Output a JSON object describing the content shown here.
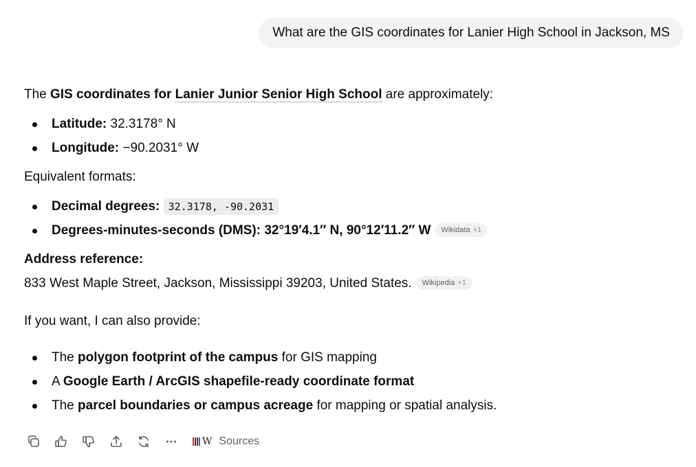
{
  "user_message": "What are the GIS coordinates for Lanier High School in Jackson, MS",
  "answer": {
    "intro": {
      "prefix": "The ",
      "bold": "GIS coordinates for ",
      "link": "Lanier Junior Senior High School",
      "suffix": " are approximately:"
    },
    "coords": [
      {
        "label": "Latitude:",
        "value": " 32.3178° N"
      },
      {
        "label": "Longitude:",
        "value": " −90.2031° W"
      }
    ],
    "equivalent_heading": "Equivalent formats:",
    "decimal": {
      "label": "Decimal degrees:",
      "code": "32.3178, -90.2031"
    },
    "dms": {
      "label": "Degrees-minutes-seconds (DMS): 32°19′4.1″ N, 90°12′11.2″ W",
      "chip": "Wikidata",
      "chip_plus": "+1"
    },
    "address_heading": "Address reference:",
    "address": {
      "text": "833 West Maple Street, Jackson, Mississippi 39203, United States.",
      "chip": "Wikipedia",
      "chip_plus": "+1"
    },
    "offer_intro": "If you want, I can also provide:",
    "offers": [
      {
        "pre": "The ",
        "bold": "polygon footprint of the campus",
        "post": " for GIS mapping"
      },
      {
        "pre": "A ",
        "bold": "Google Earth / ArcGIS shapefile-ready coordinate format",
        "post": ""
      },
      {
        "pre": "The ",
        "bold": "parcel boundaries or campus acreage",
        "post": " for mapping or spatial analysis."
      }
    ]
  },
  "toolbar": {
    "icons": [
      "copy-icon",
      "thumbs-up-icon",
      "thumbs-down-icon",
      "share-icon",
      "regenerate-icon",
      "more-icon"
    ],
    "sources_label": "Sources",
    "sources_logo_letter": "W"
  },
  "colors": {
    "bubble_bg": "#f3f3f3",
    "text": "#0d0d0d",
    "muted": "#5d5d5d",
    "chip_bg": "#f1f1f1",
    "code_bg": "#ececec"
  }
}
